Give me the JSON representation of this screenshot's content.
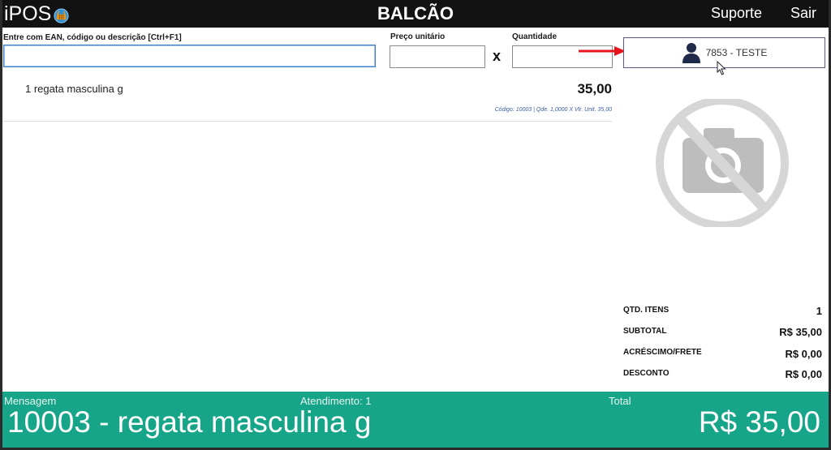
{
  "header": {
    "logo": "iPOS",
    "title": "BALCÃO",
    "nav": {
      "suporte": "Suporte",
      "sair": "Sair"
    }
  },
  "entry": {
    "ean_label": "Entre com EAN, código ou descrição [Ctrl+F1]",
    "ean_value": "",
    "price_label": "Preço unitário",
    "price_value": "",
    "times": "x",
    "qty_label": "Quantidade",
    "qty_value": ""
  },
  "customer": {
    "label": "7853 - TESTE"
  },
  "items": [
    {
      "description": "1 regata masculina g",
      "price": "35,00",
      "detail": "Código: 10003 | Qde. 1,0000  X  Vlr. Unit. 35,00"
    }
  ],
  "totals": {
    "qtd_itens_label": "QTD. ITENS",
    "qtd_itens_value": "1",
    "subtotal_label": "SUBTOTAL",
    "subtotal_value": "R$ 35,00",
    "acrescimo_label": "ACRÉSCIMO/FRETE",
    "acrescimo_value": "R$ 0,00",
    "desconto_label": "DESCONTO",
    "desconto_value": "R$ 0,00"
  },
  "footer": {
    "mensagem_label": "Mensagem",
    "atendimento_label": "Atendimento: 1",
    "total_label": "Total",
    "message": "10003 - regata masculina g",
    "total_value": "R$ 35,00"
  },
  "colors": {
    "header_bg": "#121212",
    "footer_bg": "#17a589",
    "accent_arrow": "#e8141b",
    "detail_text": "#3b5ea8"
  },
  "icons": {
    "logo": "basket-globe-icon",
    "customer": "person-icon",
    "no_photo": "no-camera-icon",
    "arrow": "red-arrow-icon",
    "cursor": "mouse-pointer-icon"
  }
}
